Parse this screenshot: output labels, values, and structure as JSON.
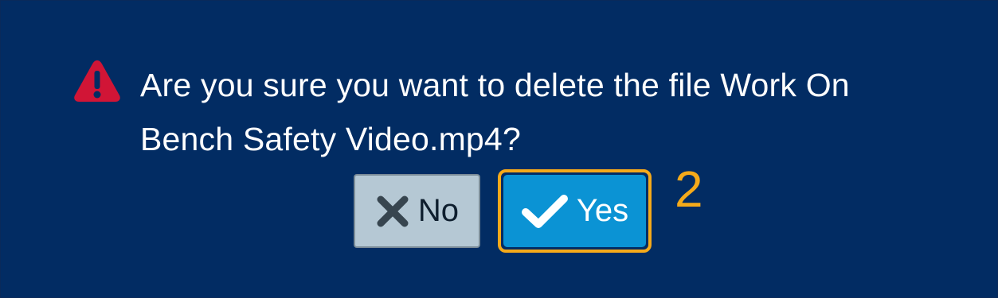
{
  "dialog": {
    "message": "Are you sure you want to delete the file Work On Bench Safety Video.mp4?",
    "icon": "warning-triangle-icon"
  },
  "buttons": {
    "no_label": "No",
    "no_icon": "x-mark-icon",
    "yes_label": "Yes",
    "yes_icon": "checkmark-icon"
  },
  "annotation": {
    "step_number": "2"
  },
  "colors": {
    "background": "#022c63",
    "warning": "#d11536",
    "no_button": "#b5c8d4",
    "yes_button": "#0b93d4",
    "highlight": "#f5aa1a"
  }
}
